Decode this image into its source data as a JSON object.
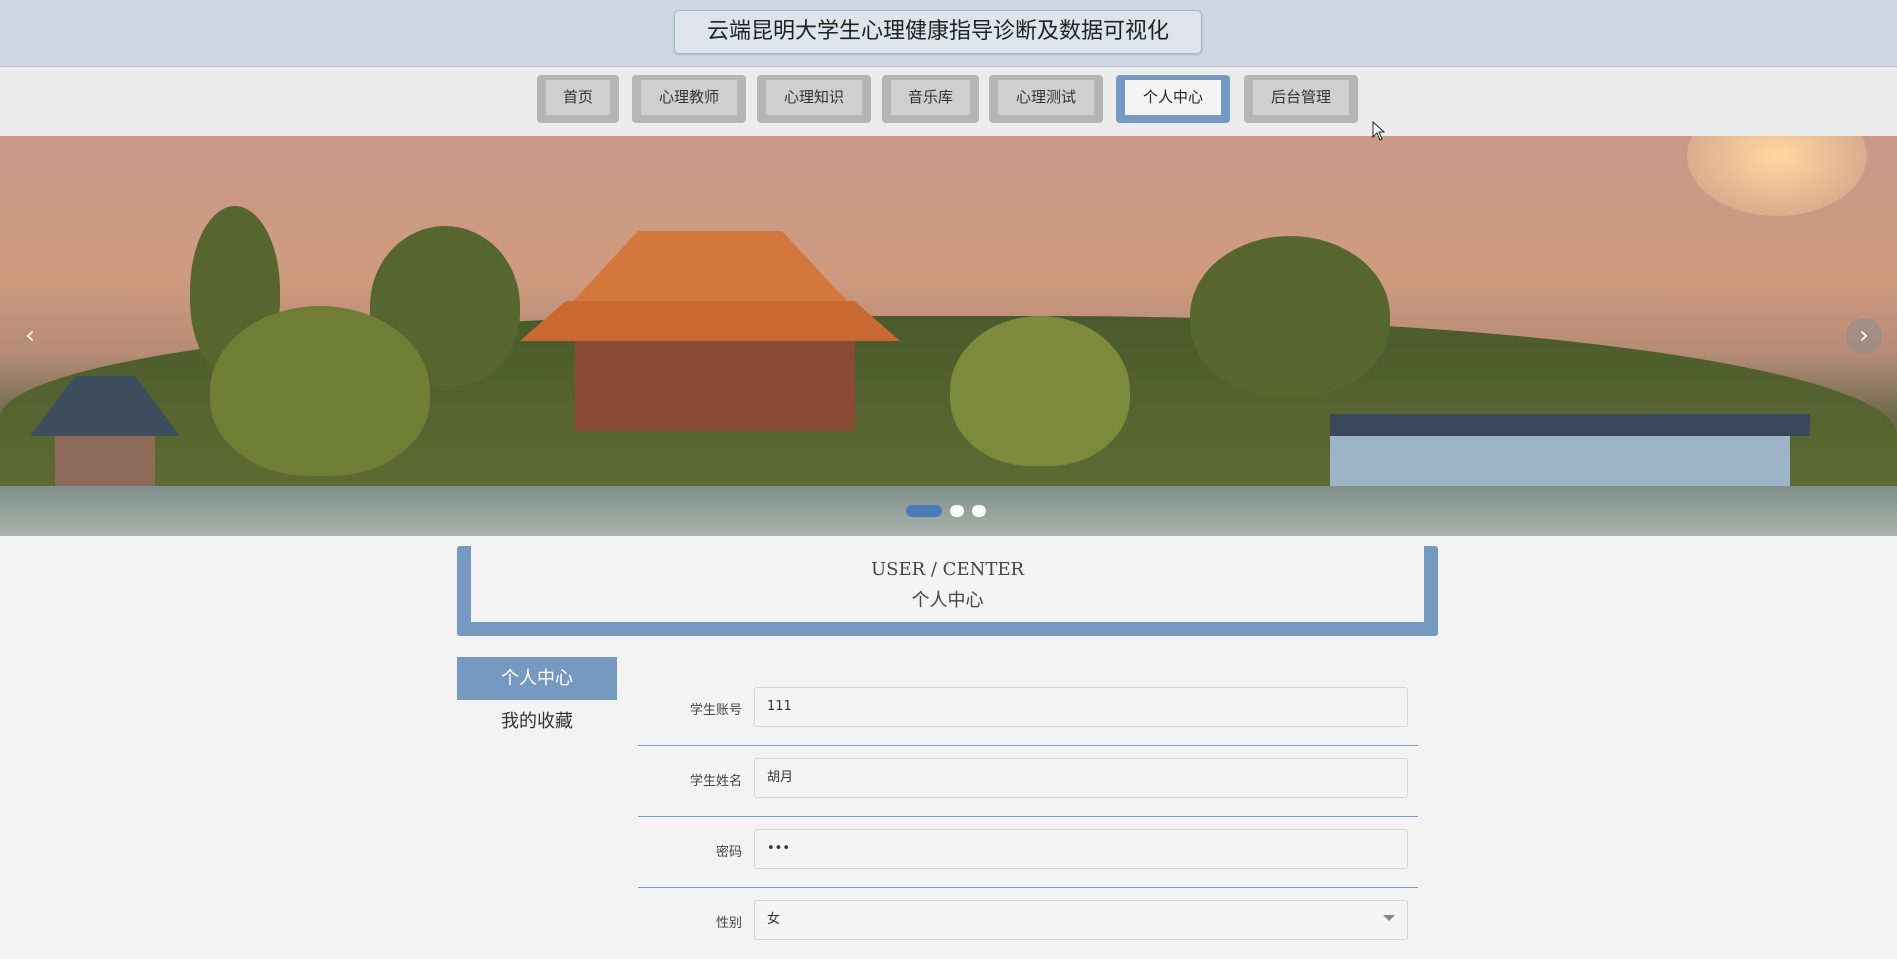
{
  "header": {
    "title": "云端昆明大学生心理健康指导诊断及数据可视化"
  },
  "nav": {
    "items": [
      {
        "label": "首页"
      },
      {
        "label": "心理教师"
      },
      {
        "label": "心理知识"
      },
      {
        "label": "音乐库"
      },
      {
        "label": "心理测试"
      },
      {
        "label": "个人中心",
        "active": true
      },
      {
        "label": "后台管理"
      }
    ]
  },
  "banner": {
    "prev_icon": "chevron-left-icon",
    "next_icon": "chevron-right-icon",
    "prev_glyph": "‹",
    "next_glyph": "›",
    "slides": 3,
    "active_slide": 1
  },
  "section": {
    "title_en": "USER / CENTER",
    "title_cn": "个人中心"
  },
  "sidebar": {
    "items": [
      {
        "label": "个人中心",
        "active": true
      },
      {
        "label": "我的收藏"
      }
    ]
  },
  "form": {
    "fields": [
      {
        "label": "学生账号",
        "value": "111"
      },
      {
        "label": "学生姓名",
        "value": "胡月"
      },
      {
        "label": "密码",
        "value": "•••"
      },
      {
        "label": "性别",
        "value": "女"
      }
    ]
  },
  "colors": {
    "accent": "#7699c0",
    "header_bg": "#cdd8e3",
    "nav_bg": "#ececec"
  }
}
